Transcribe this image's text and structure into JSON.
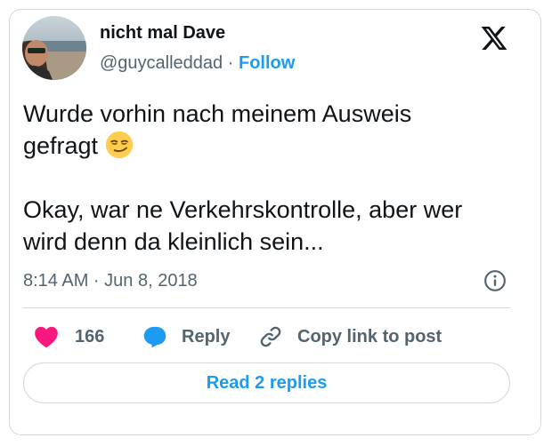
{
  "author": {
    "display_name": "nicht mal Dave",
    "handle": "@guycalleddad",
    "separator": "·",
    "follow_label": "Follow"
  },
  "brand_logo": "x-logo-icon",
  "post": {
    "line1": "Wurde vorhin nach meinem Ausweis",
    "line2": "gefragt",
    "line3": "Okay, war ne Verkehrskontrolle, aber wer",
    "line4": "wird denn da kleinlich sein...",
    "emoji": "smirking-face-icon"
  },
  "meta": {
    "timestamp": "8:14 AM · Jun 8, 2018",
    "info_icon": "info-icon"
  },
  "actions": {
    "like_count": "166",
    "reply_label": "Reply",
    "copy_link_label": "Copy link to post"
  },
  "read_replies_label": "Read 2 replies",
  "colors": {
    "accent": "#1d9bf0",
    "like": "#f91880",
    "secondary_text": "#536471",
    "border": "#cfd9de"
  }
}
